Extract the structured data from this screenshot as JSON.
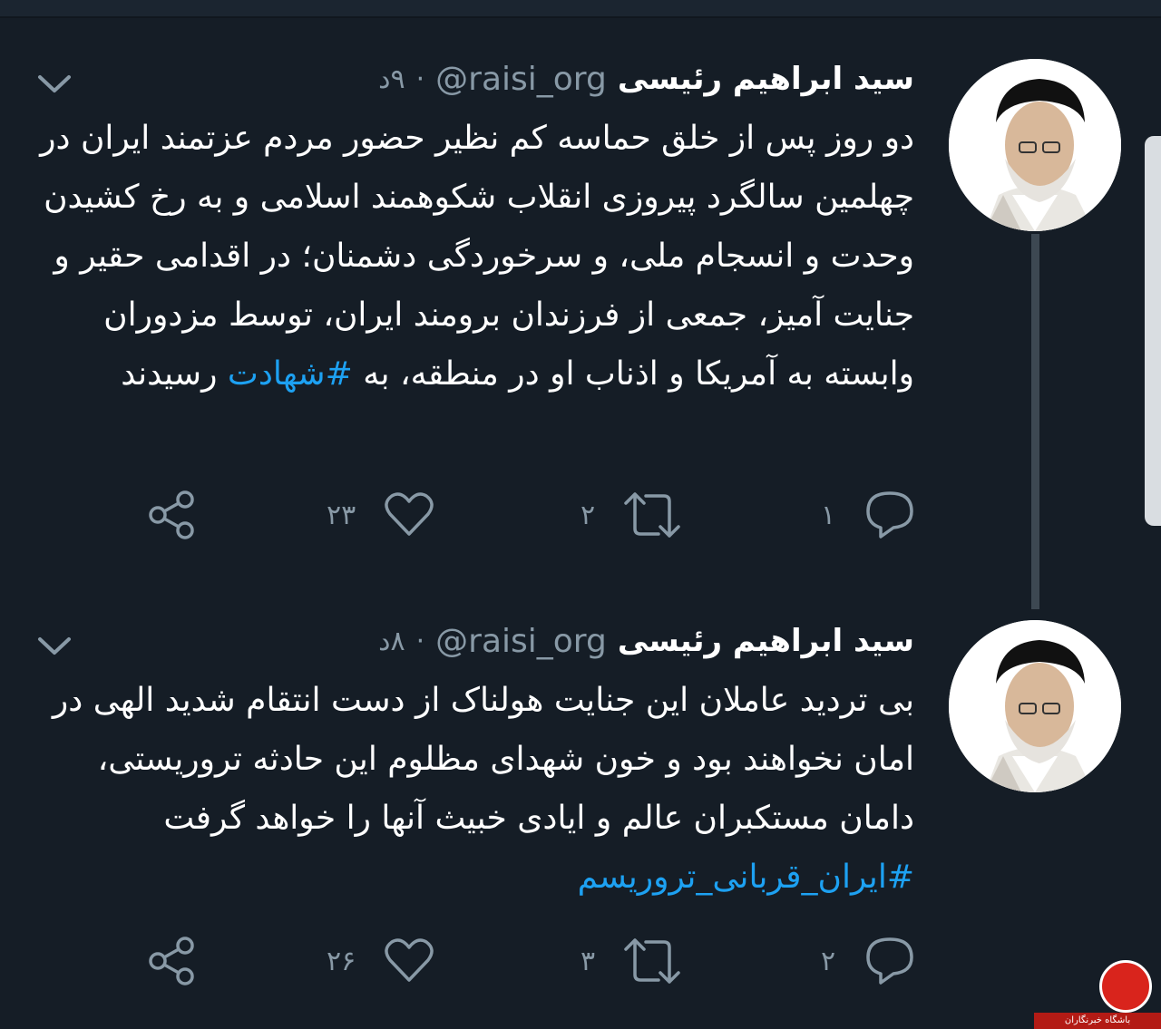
{
  "tweets": [
    {
      "name": "سید ابراهیم رئیسی",
      "handle": "@raisi_org",
      "separator": "·",
      "time": "۹د",
      "body_plain": "دو روز پس از خلق حماسه کم نظیر حضور مردم عزتمند ایران در چهلمین سالگرد پیروزی انقلاب شکوهمند اسلامی و به رخ کشیدن وحدت و انسجام ملی، و سرخوردگی دشمنان؛ در اقدامی حقیر و جنایت آمیز، جمعی از فرزندان برومند ایران، توسط مزدوران وابسته به آمریکا و اذناب او در منطقه، به",
      "hashtag": "#شهادت",
      "body_after": "رسیدند",
      "replies": "۱",
      "retweets": "۲",
      "likes": "۲۳"
    },
    {
      "name": "سید ابراهیم رئیسی",
      "handle": "@raisi_org",
      "separator": "·",
      "time": "۸د",
      "body_plain": "بی تردید عاملان این جنایت هولناک از دست انتقام شدید الهی در امان نخواهند بود و خون شهدای مظلوم این حادثه تروریستی، دامان مستکبران عالم و ایادی خبیث آنها را خواهد گرفت",
      "hashtag": "#ایران_قربانی_تروریسم",
      "body_after": "",
      "replies": "۲",
      "retweets": "۳",
      "likes": "۲۶"
    }
  ],
  "watermark": {
    "text": "باشگاه خبرنگاران"
  },
  "colors": {
    "background": "#151d26",
    "text": "#ffffff",
    "muted": "#8899a6",
    "link": "#1da1f2"
  },
  "icons": {
    "menu": "chevron-down-icon",
    "reply": "reply-icon",
    "retweet": "retweet-icon",
    "like": "heart-icon",
    "share": "share-icon"
  }
}
